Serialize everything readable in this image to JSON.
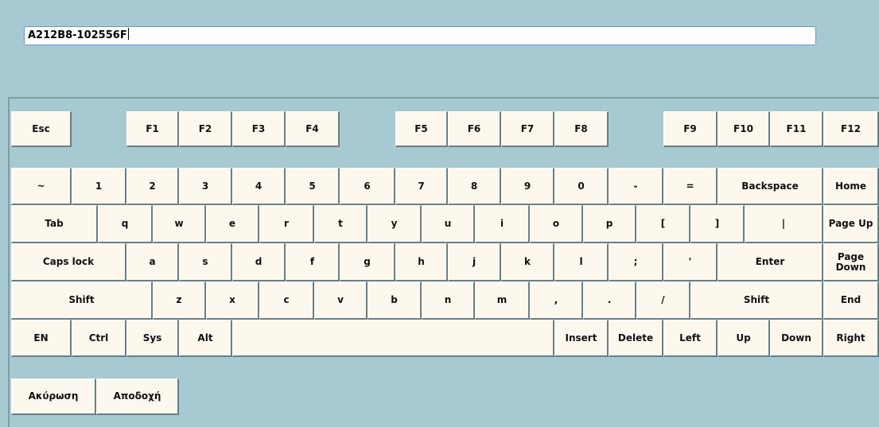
{
  "input": {
    "value": "A212B8-102556F"
  },
  "keys": {
    "esc": "Esc",
    "f1": "F1",
    "f2": "F2",
    "f3": "F3",
    "f4": "F4",
    "f5": "F5",
    "f6": "F6",
    "f7": "F7",
    "f8": "F8",
    "f9": "F9",
    "f10": "F10",
    "f11": "F11",
    "f12": "F12",
    "tilde": "~",
    "n1": "1",
    "n2": "2",
    "n3": "3",
    "n4": "4",
    "n5": "5",
    "n6": "6",
    "n7": "7",
    "n8": "8",
    "n9": "9",
    "n0": "0",
    "minus": "-",
    "equals": "=",
    "backspace": "Backspace",
    "home": "Home",
    "tab": "Tab",
    "q": "q",
    "w": "w",
    "e": "e",
    "r": "r",
    "t": "t",
    "y": "y",
    "u": "u",
    "i": "i",
    "o": "o",
    "p": "p",
    "lbracket": "[",
    "rbracket": "]",
    "pipe": "|",
    "pageup": "Page Up",
    "capslock": "Caps lock",
    "a": "a",
    "s": "s",
    "d": "d",
    "f": "f",
    "g": "g",
    "h": "h",
    "j": "j",
    "k": "k",
    "l": "l",
    "semicolon": ";",
    "quote": "'",
    "enter": "Enter",
    "pagedown": "Page\nDown",
    "shift_left": "Shift",
    "z": "z",
    "x": "x",
    "c": "c",
    "v": "v",
    "b": "b",
    "n": "n",
    "m": "m",
    "comma": ",",
    "period": ".",
    "slash": "/",
    "shift_right": "Shift",
    "end": "End",
    "en": "EN",
    "ctrl": "Ctrl",
    "sys": "Sys",
    "alt": "Alt",
    "space": "",
    "insert": "Insert",
    "delete": "Delete",
    "left": "Left",
    "up": "Up",
    "down": "Down",
    "right": "Right"
  },
  "buttons": {
    "cancel": "Ακύρωση",
    "accept": "Αποδοχή"
  }
}
